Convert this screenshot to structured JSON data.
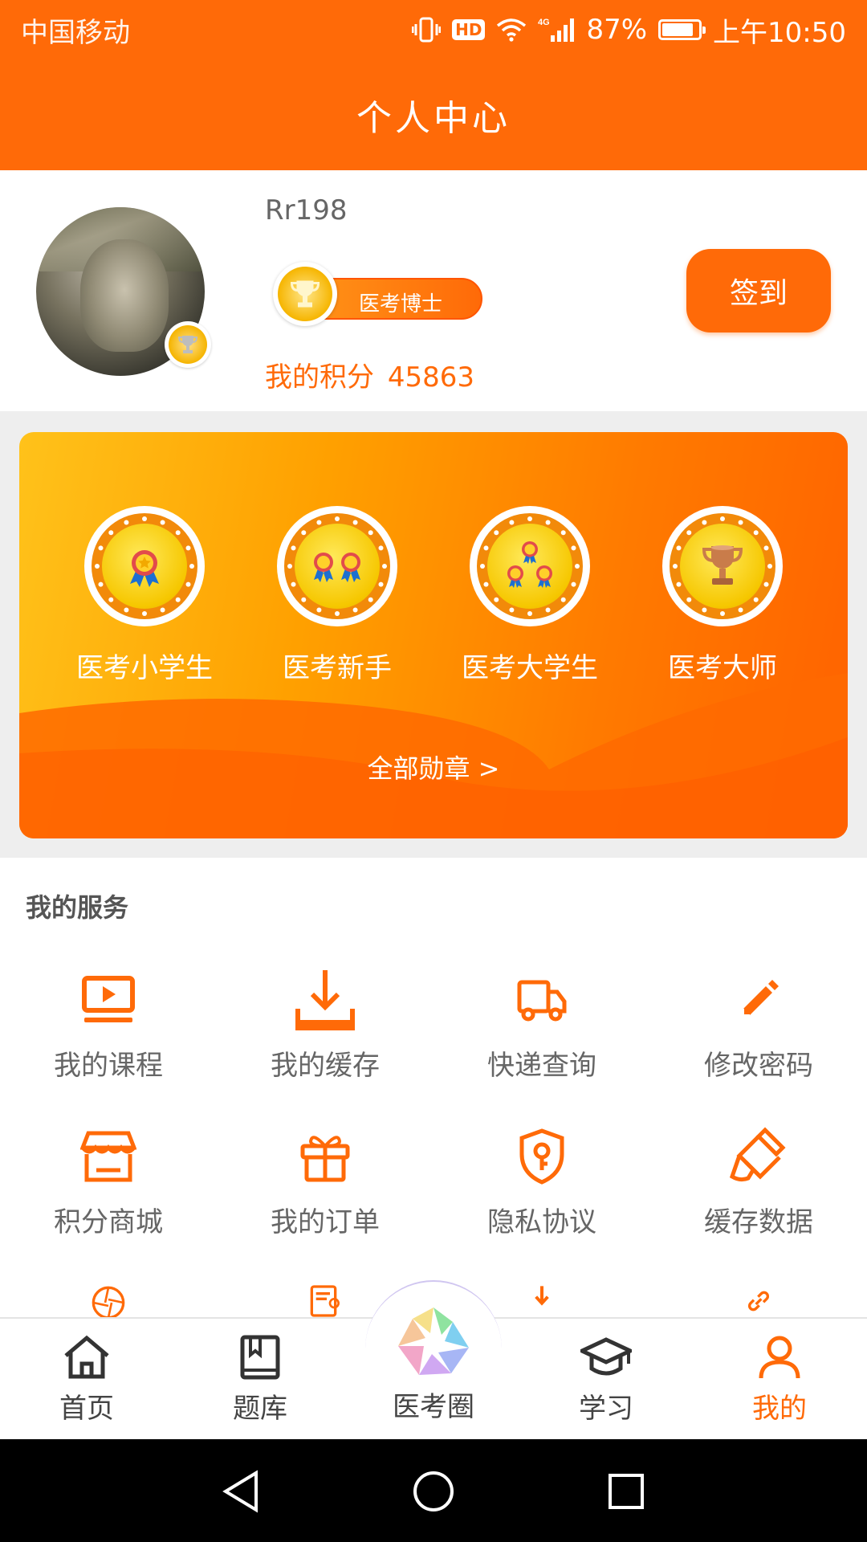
{
  "status_bar": {
    "carrier": "中国移动",
    "network": "4G",
    "battery": "87%",
    "battery_level": 0.87,
    "time": "上午10:50"
  },
  "header": {
    "title": "个人中心"
  },
  "profile": {
    "username": "Rr198",
    "rank_title": "医考博士",
    "points_label": "我的积分",
    "points_value": "45863",
    "signin_label": "签到"
  },
  "medals": {
    "items": [
      {
        "name": "医考小学生"
      },
      {
        "name": "医考新手"
      },
      {
        "name": "医考大学生"
      },
      {
        "name": "医考大师"
      }
    ],
    "all_link": "全部勋章 >"
  },
  "services": {
    "title": "我的服务",
    "items": [
      {
        "label": "我的课程",
        "icon": "video-course-icon"
      },
      {
        "label": "我的缓存",
        "icon": "download-icon"
      },
      {
        "label": "快递查询",
        "icon": "truck-icon"
      },
      {
        "label": "修改密码",
        "icon": "pencil-icon"
      },
      {
        "label": "积分商城",
        "icon": "store-icon"
      },
      {
        "label": "我的订单",
        "icon": "gift-icon"
      },
      {
        "label": "隐私协议",
        "icon": "shield-key-icon"
      },
      {
        "label": "缓存数据",
        "icon": "brush-icon"
      }
    ]
  },
  "tabbar": {
    "items": [
      {
        "label": "首页",
        "icon": "home-icon"
      },
      {
        "label": "题库",
        "icon": "book-icon"
      },
      {
        "label": "医考圈",
        "icon": "aperture-icon"
      },
      {
        "label": "学习",
        "icon": "graduation-cap-icon"
      },
      {
        "label": "我的",
        "icon": "person-icon",
        "active": true
      }
    ]
  },
  "colors": {
    "accent": "#ff6a08",
    "text_gray": "#666666"
  }
}
